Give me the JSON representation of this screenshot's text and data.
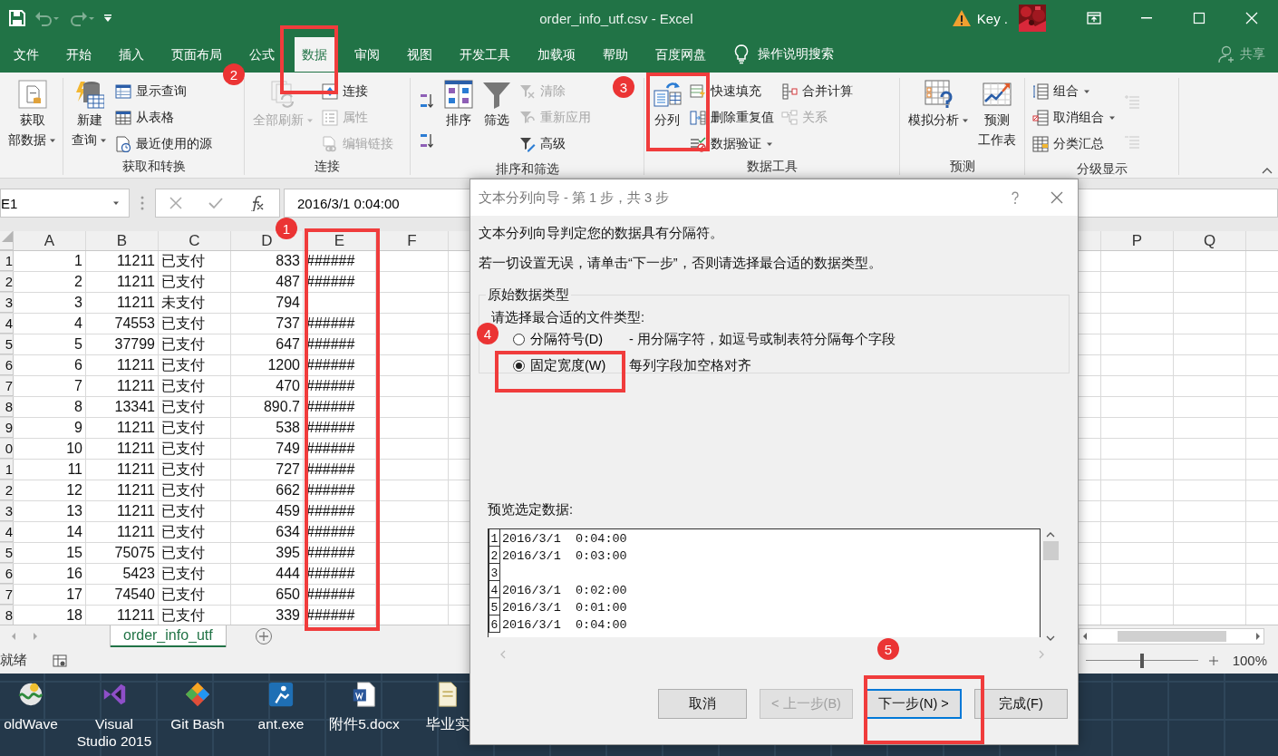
{
  "window": {
    "title": "order_info_utf.csv  -  Excel",
    "user": "Key ."
  },
  "ribbon_tabs": [
    {
      "label": "文件",
      "selected": false
    },
    {
      "label": "开始",
      "selected": false
    },
    {
      "label": "插入",
      "selected": false
    },
    {
      "label": "页面布局",
      "selected": false
    },
    {
      "label": "公式",
      "selected": false
    },
    {
      "label": "数据",
      "selected": true
    },
    {
      "label": "审阅",
      "selected": false
    },
    {
      "label": "视图",
      "selected": false
    },
    {
      "label": "开发工具",
      "selected": false
    },
    {
      "label": "加载项",
      "selected": false
    },
    {
      "label": "帮助",
      "selected": false
    },
    {
      "label": "百度网盘",
      "selected": false
    }
  ],
  "tell_me": "操作说明搜索",
  "share": "共享",
  "ribbon_groups": [
    {
      "items": [
        {
          "kind": "large",
          "lines": [
            "获取",
            "部数据"
          ],
          "dropdown": true,
          "disabled": false
        }
      ]
    },
    {
      "label": "获取和转换",
      "items": [
        {
          "kind": "large",
          "lines": [
            "新建",
            "查询"
          ],
          "dropdown": true,
          "disabled": false
        },
        {
          "kind": "small",
          "lines": [
            "显示查询"
          ],
          "dropdown": false,
          "disabled": false
        },
        {
          "kind": "small",
          "lines": [
            "从表格"
          ],
          "dropdown": false,
          "disabled": false
        },
        {
          "kind": "small",
          "lines": [
            "最近使用的源"
          ],
          "dropdown": false,
          "disabled": false
        }
      ]
    },
    {
      "label": "连接",
      "items": [
        {
          "kind": "large",
          "lines": [
            "全部刷新"
          ],
          "dropdown": true,
          "disabled": true
        },
        {
          "kind": "small",
          "lines": [
            "连接"
          ],
          "dropdown": false,
          "disabled": false
        },
        {
          "kind": "small",
          "lines": [
            "属性"
          ],
          "dropdown": false,
          "disabled": true
        },
        {
          "kind": "small",
          "lines": [
            "编辑链接"
          ],
          "dropdown": false,
          "disabled": true
        }
      ]
    },
    {
      "label": "排序和筛选",
      "items": [
        {
          "kind": "icon",
          "disabled": false
        },
        {
          "kind": "icon",
          "disabled": false
        },
        {
          "kind": "large",
          "lines": [
            "排序"
          ],
          "dropdown": false,
          "disabled": false
        },
        {
          "kind": "large",
          "lines": [
            "筛选"
          ],
          "dropdown": false,
          "disabled": false
        },
        {
          "kind": "small",
          "lines": [
            "清除"
          ],
          "dropdown": false,
          "disabled": true
        },
        {
          "kind": "small",
          "lines": [
            "重新应用"
          ],
          "dropdown": false,
          "disabled": true
        },
        {
          "kind": "small",
          "lines": [
            "高级"
          ],
          "dropdown": false,
          "disabled": false
        }
      ]
    },
    {
      "label": "数据工具",
      "items": [
        {
          "kind": "large",
          "lines": [
            "分列"
          ],
          "dropdown": false,
          "disabled": false
        },
        {
          "kind": "small",
          "lines": [
            "快速填充"
          ],
          "dropdown": false,
          "disabled": false
        },
        {
          "kind": "small",
          "lines": [
            "删除重复值"
          ],
          "dropdown": false,
          "disabled": false
        },
        {
          "kind": "small",
          "lines": [
            "数据验证"
          ],
          "dropdown": true,
          "disabled": false
        },
        {
          "kind": "small",
          "lines": [
            "合并计算"
          ],
          "dropdown": false,
          "disabled": false
        },
        {
          "kind": "small",
          "lines": [
            "关系"
          ],
          "dropdown": false,
          "disabled": true
        }
      ]
    },
    {
      "label": "预测",
      "items": [
        {
          "kind": "large",
          "lines": [
            "模拟分析"
          ],
          "dropdown": true,
          "disabled": false
        },
        {
          "kind": "large",
          "lines": [
            "预测",
            "工作表"
          ],
          "dropdown": false,
          "disabled": false
        }
      ]
    },
    {
      "label": "分级显示",
      "items": [
        {
          "kind": "small",
          "lines": [
            "组合"
          ],
          "dropdown": true,
          "disabled": false
        },
        {
          "kind": "small",
          "lines": [
            "取消组合"
          ],
          "dropdown": true,
          "disabled": false
        },
        {
          "kind": "small",
          "lines": [
            "分类汇总"
          ],
          "dropdown": false,
          "disabled": false
        },
        {
          "kind": "icon",
          "disabled": true
        },
        {
          "kind": "icon",
          "disabled": true
        }
      ]
    }
  ],
  "formula_bar": {
    "name_box": "E1",
    "formula": "2016/3/1  0:04:00"
  },
  "sheet": {
    "columns": [
      "A",
      "B",
      "C",
      "D",
      "E",
      "F",
      "P",
      "Q"
    ],
    "rows": [
      {
        "header": "1",
        "cells": [
          "1",
          "11211",
          "已支付",
          "833",
          "######"
        ]
      },
      {
        "header": "2",
        "cells": [
          "2",
          "11211",
          "已支付",
          "487",
          "######"
        ]
      },
      {
        "header": "3",
        "cells": [
          "3",
          "11211",
          "未支付",
          "794",
          ""
        ]
      },
      {
        "header": "4",
        "cells": [
          "4",
          "74553",
          "已支付",
          "737",
          "######"
        ]
      },
      {
        "header": "5",
        "cells": [
          "5",
          "37799",
          "已支付",
          "647",
          "######"
        ]
      },
      {
        "header": "6",
        "cells": [
          "6",
          "11211",
          "已支付",
          "1200",
          "######"
        ]
      },
      {
        "header": "7",
        "cells": [
          "7",
          "11211",
          "已支付",
          "470",
          "######"
        ]
      },
      {
        "header": "8",
        "cells": [
          "8",
          "13341",
          "已支付",
          "890.7",
          "######"
        ]
      },
      {
        "header": "9",
        "cells": [
          "9",
          "11211",
          "已支付",
          "538",
          "######"
        ]
      },
      {
        "header": "0",
        "cells": [
          "10",
          "11211",
          "已支付",
          "749",
          "######"
        ]
      },
      {
        "header": "1",
        "cells": [
          "11",
          "11211",
          "已支付",
          "727",
          "######"
        ]
      },
      {
        "header": "2",
        "cells": [
          "12",
          "11211",
          "已支付",
          "662",
          "######"
        ]
      },
      {
        "header": "3",
        "cells": [
          "13",
          "11211",
          "已支付",
          "459",
          "######"
        ]
      },
      {
        "header": "4",
        "cells": [
          "14",
          "11211",
          "已支付",
          "634",
          "######"
        ]
      },
      {
        "header": "5",
        "cells": [
          "15",
          "75075",
          "已支付",
          "395",
          "######"
        ]
      },
      {
        "header": "6",
        "cells": [
          "16",
          "5423",
          "已支付",
          "444",
          "######"
        ]
      },
      {
        "header": "7",
        "cells": [
          "17",
          "74540",
          "已支付",
          "650",
          "######"
        ]
      },
      {
        "header": "8",
        "cells": [
          "18",
          "11211",
          "已支付",
          "339",
          "######"
        ]
      }
    ]
  },
  "sheet_tabs": [
    {
      "label": "order_info_utf",
      "selected": true
    }
  ],
  "status_bar": {
    "status": "就绪",
    "zoom": "100%",
    "zoom_slider": {
      "level": 0.5
    }
  },
  "desktop_icons": [
    {
      "lines": [
        "oldWave"
      ]
    },
    {
      "lines": [
        "Visual",
        "Studio 2015"
      ]
    },
    {
      "lines": [
        "Git Bash"
      ]
    },
    {
      "lines": [
        "ant.exe"
      ]
    },
    {
      "lines": [
        "附件5.docx"
      ]
    },
    {
      "lines": [
        "毕业实"
      ]
    }
  ],
  "dialog": {
    "title": "文本分列向导 - 第 1 步，共 3 步",
    "intro": "文本分列向导判定您的数据具有分隔符。",
    "instruction": "若一切设置无误，请单击“下一步”，否则请选择最合适的数据类型。",
    "group_title": "原始数据类型",
    "prompt": "请选择最合适的文件类型:",
    "options": [
      {
        "label": "分隔符号(D)",
        "description": "- 用分隔字符，如逗号或制表符分隔每个字段",
        "selected": false
      },
      {
        "label": "固定宽度(W)",
        "description": "每列字段加空格对齐",
        "selected": true
      }
    ],
    "preview_label": "预览选定数据:",
    "preview_rows": [
      {
        "number": "1",
        "text": "2016/3/1  0:04:00"
      },
      {
        "number": "2",
        "text": "2016/3/1  0:03:00"
      },
      {
        "number": "3",
        "text": ""
      },
      {
        "number": "4",
        "text": "2016/3/1  0:02:00"
      },
      {
        "number": "5",
        "text": "2016/3/1  0:01:00"
      },
      {
        "number": "6",
        "text": "2016/3/1  0:04:00"
      }
    ],
    "buttons": [
      {
        "label": "取消",
        "disabled": false,
        "focused": false
      },
      {
        "label": "< 上一步(B)",
        "disabled": true,
        "focused": false
      },
      {
        "label": "下一步(N) >",
        "disabled": false,
        "focused": true
      },
      {
        "label": "完成(F)",
        "disabled": false,
        "focused": false
      }
    ]
  },
  "annotation_badges": [
    "1",
    "2",
    "3",
    "4",
    "5"
  ]
}
